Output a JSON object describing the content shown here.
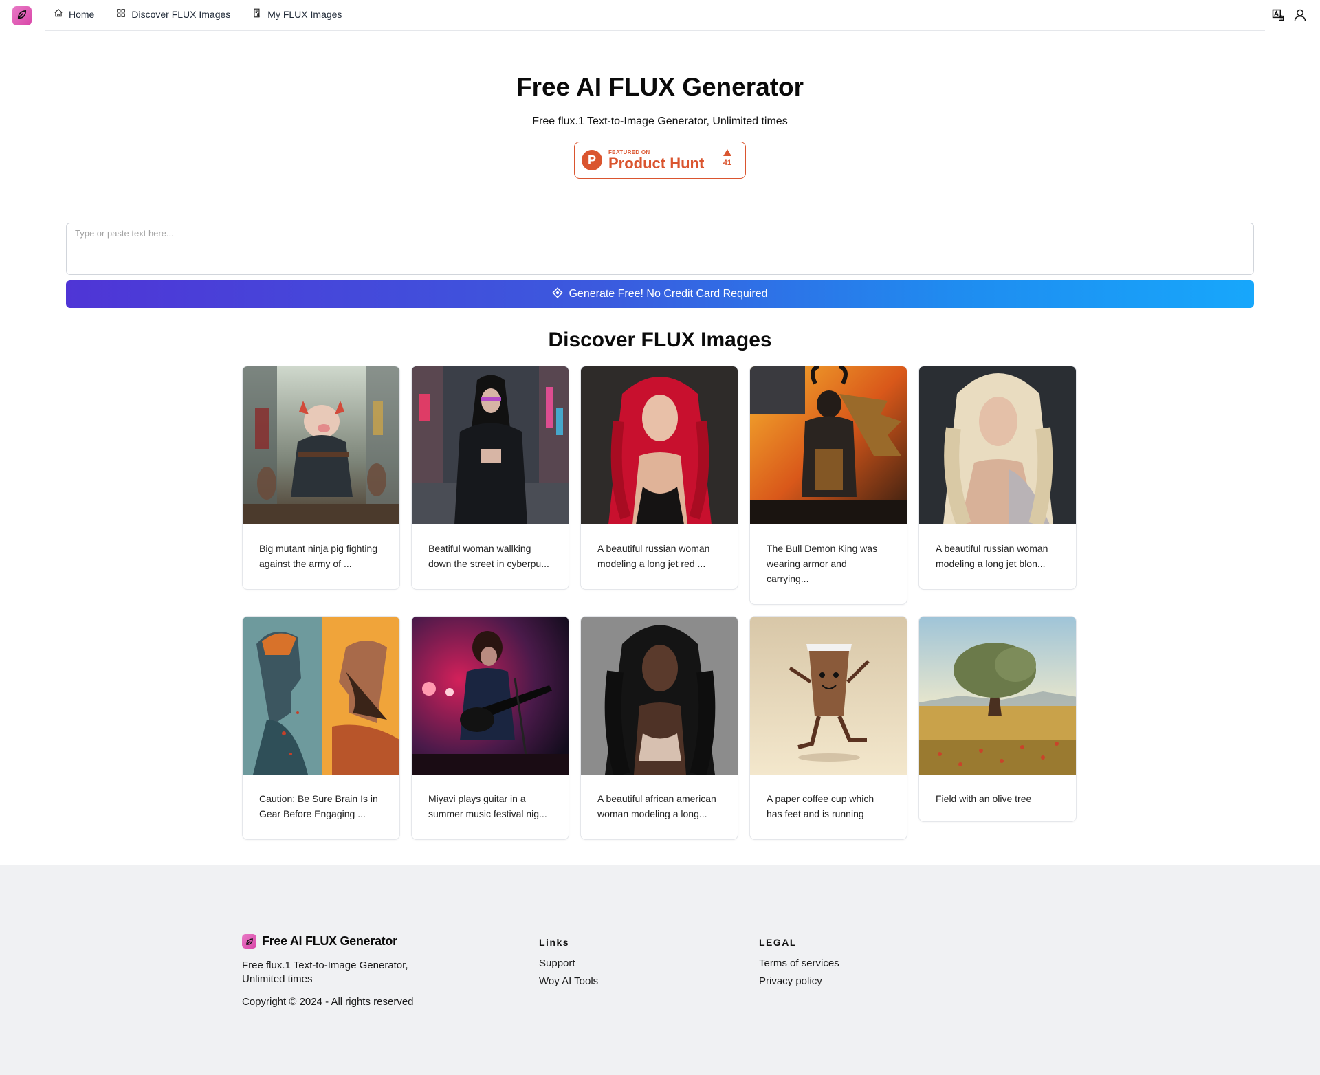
{
  "nav": {
    "logo_icon": "leaf-icon",
    "links": [
      {
        "label": "Home",
        "icon": "home-icon"
      },
      {
        "label": "Discover FLUX Images",
        "icon": "grid-icon"
      },
      {
        "label": "My FLUX Images",
        "icon": "document-user-icon"
      }
    ],
    "right_icons": [
      "translate-icon",
      "user-icon"
    ]
  },
  "hero": {
    "title": "Free AI FLUX Generator",
    "subtitle": "Free flux.1 Text-to-Image Generator, Unlimited times",
    "product_hunt": {
      "featured_label": "FEATURED ON",
      "name": "Product Hunt",
      "letter": "P",
      "votes": "41",
      "color": "#da552f"
    }
  },
  "prompt": {
    "value": "",
    "placeholder": "Type or paste text here..."
  },
  "generate_button": {
    "label": "Generate Free! No Credit Card Required",
    "icon": "diamond-icon",
    "gradient": [
      "#4f35d6",
      "#17a7fb"
    ]
  },
  "gallery": {
    "title": "Discover FLUX Images",
    "items": [
      {
        "caption": "Big mutant ninja pig fighting against the army of ...",
        "scene": "ninja-pig"
      },
      {
        "caption": "Beatiful woman wallking down the street in cyberpu...",
        "scene": "cyberpunk-woman"
      },
      {
        "caption": "A beautiful russian woman modeling a long jet red ...",
        "scene": "red-hair-woman"
      },
      {
        "caption": "The Bull Demon King was wearing armor and carrying...",
        "scene": "bull-demon"
      },
      {
        "caption": "A beautiful russian woman modeling a long jet blon...",
        "scene": "blonde-woman"
      },
      {
        "caption": "Caution: Be Sure Brain Is in Gear Before Engaging ...",
        "scene": "brain-faces"
      },
      {
        "caption": "Miyavi plays guitar in a summer music festival nig...",
        "scene": "guitarist"
      },
      {
        "caption": "A beautiful african american woman modeling a long...",
        "scene": "black-hair-woman"
      },
      {
        "caption": "A paper coffee cup which has feet and is running",
        "scene": "coffee-cup"
      },
      {
        "caption": "Field with an olive tree",
        "scene": "olive-tree"
      }
    ]
  },
  "footer": {
    "brand": "Free AI FLUX Generator",
    "description": "Free flux.1 Text-to-Image Generator, Unlimited times",
    "copyright": "Copyright © 2024 - All rights reserved",
    "links_title": "Links",
    "links": [
      "Support",
      "Woy AI Tools"
    ],
    "legal_title": "LEGAL",
    "legal": [
      "Terms of services",
      "Privacy policy"
    ]
  }
}
